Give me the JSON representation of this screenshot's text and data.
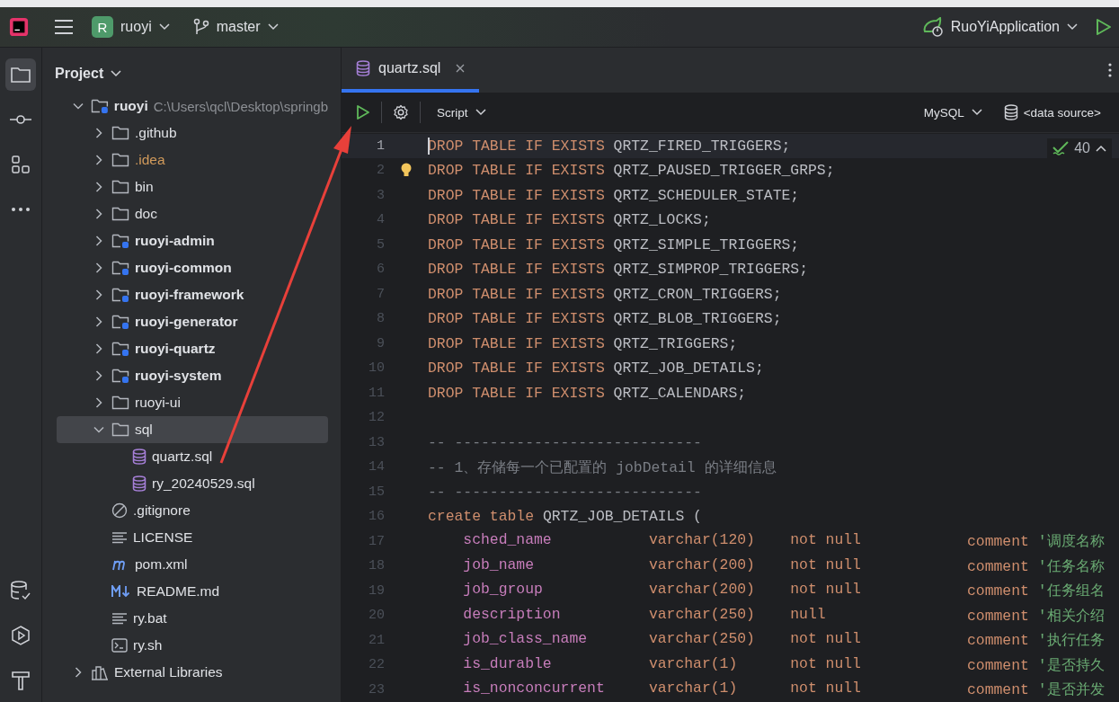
{
  "title_bar": {
    "project_badge": "R",
    "project": "ruoyi",
    "branch": "master",
    "run_config": "RuoYiApplication"
  },
  "tool_strip": {
    "top": [
      {
        "kind": "folder",
        "selected": true
      },
      {
        "kind": "commit",
        "selected": false
      },
      {
        "kind": "structure",
        "selected": false
      },
      {
        "kind": "more",
        "selected": false
      }
    ],
    "bottom": [
      {
        "kind": "database",
        "selected": false
      },
      {
        "kind": "services",
        "selected": false
      },
      {
        "kind": "build",
        "selected": false
      }
    ]
  },
  "project_panel": {
    "title": "Project",
    "tree": [
      {
        "name": "ruoyi",
        "path": "C:\\Users\\qcl\\Desktop\\springb",
        "kind": "module",
        "expanded": true,
        "selected": false,
        "ignored": false,
        "children": [
          {
            "name": ".github",
            "kind": "folder",
            "expanded": false,
            "selected": false,
            "ignored": false
          },
          {
            "name": ".idea",
            "kind": "folder",
            "expanded": false,
            "selected": false,
            "ignored": true
          },
          {
            "name": "bin",
            "kind": "folder",
            "expanded": false,
            "selected": false,
            "ignored": false
          },
          {
            "name": "doc",
            "kind": "folder",
            "expanded": false,
            "selected": false,
            "ignored": false
          },
          {
            "name": "ruoyi-admin",
            "kind": "module",
            "expanded": false,
            "selected": false,
            "ignored": false
          },
          {
            "name": "ruoyi-common",
            "kind": "module",
            "expanded": false,
            "selected": false,
            "ignored": false
          },
          {
            "name": "ruoyi-framework",
            "kind": "module",
            "expanded": false,
            "selected": false,
            "ignored": false
          },
          {
            "name": "ruoyi-generator",
            "kind": "module",
            "expanded": false,
            "selected": false,
            "ignored": false
          },
          {
            "name": "ruoyi-quartz",
            "kind": "module",
            "expanded": false,
            "selected": false,
            "ignored": false
          },
          {
            "name": "ruoyi-system",
            "kind": "module",
            "expanded": false,
            "selected": false,
            "ignored": false
          },
          {
            "name": "ruoyi-ui",
            "kind": "folder",
            "expanded": false,
            "selected": false,
            "ignored": false
          },
          {
            "name": "sql",
            "kind": "folder",
            "expanded": true,
            "selected": true,
            "ignored": false,
            "children": [
              {
                "name": "quartz.sql",
                "kind": "sql",
                "selected": false,
                "ignored": false
              },
              {
                "name": "ry_20240529.sql",
                "kind": "sql",
                "selected": false,
                "ignored": false
              }
            ]
          },
          {
            "name": ".gitignore",
            "kind": "ignore",
            "selected": false,
            "ignored": false
          },
          {
            "name": "LICENSE",
            "kind": "text",
            "selected": false,
            "ignored": false
          },
          {
            "name": "pom.xml",
            "kind": "maven",
            "selected": false,
            "ignored": false
          },
          {
            "name": "README.md",
            "kind": "markdown",
            "selected": false,
            "ignored": false
          },
          {
            "name": "ry.bat",
            "kind": "text",
            "selected": false,
            "ignored": false
          },
          {
            "name": "ry.sh",
            "kind": "shell",
            "selected": false,
            "ignored": false
          }
        ]
      },
      {
        "name": "External Libraries",
        "kind": "libraries",
        "expanded": false,
        "selected": false,
        "ignored": false
      }
    ]
  },
  "editor": {
    "tabs": [
      {
        "label": "quartz.sql",
        "selected": true
      }
    ],
    "toolbar": {
      "mode": "Script",
      "dialect": "MySQL",
      "data_source": "<data source>"
    },
    "inspections": {
      "count": "40"
    },
    "lines": [
      {
        "number": "1",
        "current": true,
        "kind": "statement",
        "keyword": "DROP TABLE IF EXISTS",
        "name": "QRTZ_FIRED_TRIGGERS;"
      },
      {
        "number": "2",
        "current": false,
        "kind": "statement",
        "keyword": "DROP TABLE IF EXISTS",
        "name": "QRTZ_PAUSED_TRIGGER_GRPS;"
      },
      {
        "number": "3",
        "current": false,
        "kind": "statement",
        "keyword": "DROP TABLE IF EXISTS",
        "name": "QRTZ_SCHEDULER_STATE;"
      },
      {
        "number": "4",
        "current": false,
        "kind": "statement",
        "keyword": "DROP TABLE IF EXISTS",
        "name": "QRTZ_LOCKS;"
      },
      {
        "number": "5",
        "current": false,
        "kind": "statement",
        "keyword": "DROP TABLE IF EXISTS",
        "name": "QRTZ_SIMPLE_TRIGGERS;"
      },
      {
        "number": "6",
        "current": false,
        "kind": "statement",
        "keyword": "DROP TABLE IF EXISTS",
        "name": "QRTZ_SIMPROP_TRIGGERS;"
      },
      {
        "number": "7",
        "current": false,
        "kind": "statement",
        "keyword": "DROP TABLE IF EXISTS",
        "name": "QRTZ_CRON_TRIGGERS;"
      },
      {
        "number": "8",
        "current": false,
        "kind": "statement",
        "keyword": "DROP TABLE IF EXISTS",
        "name": "QRTZ_BLOB_TRIGGERS;"
      },
      {
        "number": "9",
        "current": false,
        "kind": "statement",
        "keyword": "DROP TABLE IF EXISTS",
        "name": "QRTZ_TRIGGERS;"
      },
      {
        "number": "10",
        "current": false,
        "kind": "statement",
        "keyword": "DROP TABLE IF EXISTS",
        "name": "QRTZ_JOB_DETAILS;"
      },
      {
        "number": "11",
        "current": false,
        "kind": "statement",
        "keyword": "DROP TABLE IF EXISTS",
        "name": "QRTZ_CALENDARS;"
      },
      {
        "number": "12",
        "current": false,
        "kind": "blank"
      },
      {
        "number": "13",
        "current": false,
        "kind": "comment",
        "text": "-- ----------------------------"
      },
      {
        "number": "14",
        "current": false,
        "kind": "comment",
        "text": "-- 1、存储每一个已配置的 jobDetail 的详细信息"
      },
      {
        "number": "15",
        "current": false,
        "kind": "comment",
        "text": "-- ----------------------------"
      },
      {
        "number": "16",
        "current": false,
        "kind": "statement",
        "keyword": "create table",
        "name": "QRTZ_JOB_DETAILS ("
      },
      {
        "number": "17",
        "current": false,
        "kind": "column",
        "column": "sched_name",
        "type": "varchar(120)",
        "nullability": "not null",
        "comment_keyword": "comment",
        "comment": "'调度名称"
      },
      {
        "number": "18",
        "current": false,
        "kind": "column",
        "column": "job_name",
        "type": "varchar(200)",
        "nullability": "not null",
        "comment_keyword": "comment",
        "comment": "'任务名称"
      },
      {
        "number": "19",
        "current": false,
        "kind": "column",
        "column": "job_group",
        "type": "varchar(200)",
        "nullability": "not null",
        "comment_keyword": "comment",
        "comment": "'任务组名"
      },
      {
        "number": "20",
        "current": false,
        "kind": "column",
        "column": "description",
        "type": "varchar(250)",
        "nullability": "null",
        "comment_keyword": "comment",
        "comment": "'相关介绍"
      },
      {
        "number": "21",
        "current": false,
        "kind": "column",
        "column": "job_class_name",
        "type": "varchar(250)",
        "nullability": "not null",
        "comment_keyword": "comment",
        "comment": "'执行任务"
      },
      {
        "number": "22",
        "current": false,
        "kind": "column",
        "column": "is_durable",
        "type": "varchar(1)",
        "nullability": "not null",
        "comment_keyword": "comment",
        "comment": "'是否持久"
      },
      {
        "number": "23",
        "current": false,
        "kind": "column",
        "column": "is_nonconcurrent",
        "type": "varchar(1)",
        "nullability": "not null",
        "comment_keyword": "comment",
        "comment": "'是否并发"
      }
    ]
  }
}
